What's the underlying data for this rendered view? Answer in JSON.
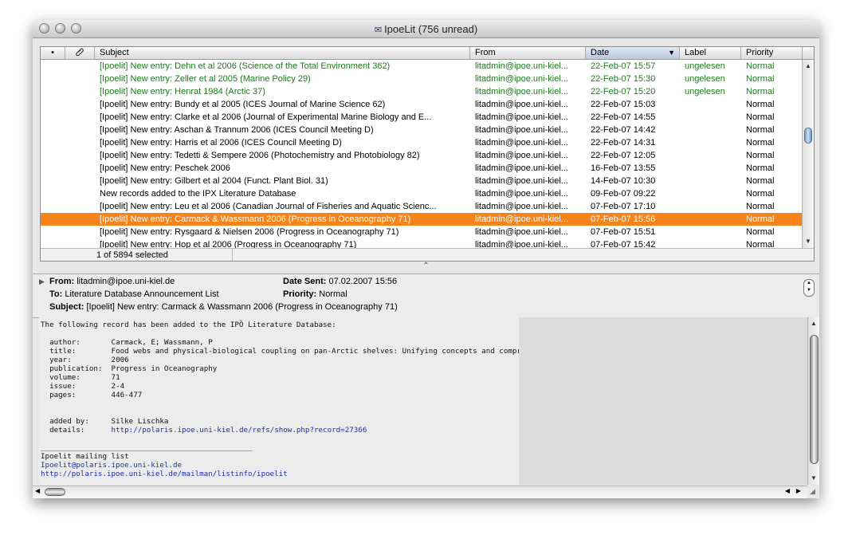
{
  "window": {
    "title": "IpoeLit (756 unread)"
  },
  "colors": {
    "unread_text": "#1b7b1b",
    "selected_row": "#f7841b",
    "link": "#1a2fa8"
  },
  "columns": {
    "dot": "•",
    "attachment_icon": "paperclip-icon",
    "subject": "Subject",
    "from": "From",
    "date": "Date",
    "label": "Label",
    "priority": "Priority"
  },
  "messages": [
    {
      "subject": "[Ipoelit] New entry: Dehn et al 2006 (Science of the Total Environment 362)",
      "from": "litadmin@ipoe.uni-kiel...",
      "date": "22-Feb-07 15:57",
      "label": "ungelesen",
      "priority": "Normal",
      "state": "unread"
    },
    {
      "subject": "[Ipoelit] New entry: Zeller et al 2005 (Marine Policy 29)",
      "from": "litadmin@ipoe.uni-kiel...",
      "date": "22-Feb-07 15:30",
      "label": "ungelesen",
      "priority": "Normal",
      "state": "unread"
    },
    {
      "subject": "[Ipoelit] New entry: Henrat 1984 (Arctic 37)",
      "from": "litadmin@ipoe.uni-kiel...",
      "date": "22-Feb-07 15:20",
      "label": "ungelesen",
      "priority": "Normal",
      "state": "unread"
    },
    {
      "subject": "[Ipoelit] New entry: Bundy et al 2005 (ICES Journal of Marine Science 62)",
      "from": "litadmin@ipoe.uni-kiel...",
      "date": "22-Feb-07 15:03",
      "label": "",
      "priority": "Normal",
      "state": "read"
    },
    {
      "subject": "[Ipoelit] New entry: Clarke et al 2006 (Journal of Experimental Marine Biology and E...",
      "from": "litadmin@ipoe.uni-kiel...",
      "date": "22-Feb-07 14:55",
      "label": "",
      "priority": "Normal",
      "state": "read"
    },
    {
      "subject": "[Ipoelit] New entry: Aschan & Trannum 2006 (ICES Council Meeting D)",
      "from": "litadmin@ipoe.uni-kiel...",
      "date": "22-Feb-07 14:42",
      "label": "",
      "priority": "Normal",
      "state": "read"
    },
    {
      "subject": "[Ipoelit] New entry: Harris et al 2006 (ICES Council Meeting D)",
      "from": "litadmin@ipoe.uni-kiel...",
      "date": "22-Feb-07 14:31",
      "label": "",
      "priority": "Normal",
      "state": "read"
    },
    {
      "subject": "[Ipoelit] New entry: Tedetti & Sempere 2006 (Photochemistry and Photobiology 82)",
      "from": "litadmin@ipoe.uni-kiel...",
      "date": "22-Feb-07 12:05",
      "label": "",
      "priority": "Normal",
      "state": "read"
    },
    {
      "subject": "[Ipoelit] New entry: Peschek 2006",
      "from": "litadmin@ipoe.uni-kiel...",
      "date": "16-Feb-07 13:55",
      "label": "",
      "priority": "Normal",
      "state": "read"
    },
    {
      "subject": "[Ipoelit] New entry: Gilbert et al 2004 (Funct. Plant Biol. 31)",
      "from": "litadmin@ipoe.uni-kiel...",
      "date": "14-Feb-07 10:30",
      "label": "",
      "priority": "Normal",
      "state": "read"
    },
    {
      "subject": "New records added to the IPX Literature Database",
      "from": "litadmin@ipoe.uni-kiel...",
      "date": "09-Feb-07 09:22",
      "label": "",
      "priority": "Normal",
      "state": "read"
    },
    {
      "subject": "[Ipoelit] New entry: Leu et al 2006 (Canadian Journal of Fisheries and Aquatic Scienc...",
      "from": "litadmin@ipoe.uni-kiel...",
      "date": "07-Feb-07 17:10",
      "label": "",
      "priority": "Normal",
      "state": "read"
    },
    {
      "subject": "[Ipoelit] New entry: Carmack & Wassmann 2006 (Progress in Oceanography 71)",
      "from": "litadmin@ipoe.uni-kiel...",
      "date": "07-Feb-07 15:56",
      "label": "",
      "priority": "Normal",
      "state": "selected"
    },
    {
      "subject": "[Ipoelit] New entry: Rysgaard & Nielsen 2006 (Progress in Oceanography 71)",
      "from": "litadmin@ipoe.uni-kiel...",
      "date": "07-Feb-07 15:51",
      "label": "",
      "priority": "Normal",
      "state": "read"
    },
    {
      "subject": "[Ipoelit] New entry: Hop et al 2006 (Progress in Oceanography 71)",
      "from": "litadmin@ipoe.uni-kiel...",
      "date": "07-Feb-07 15:42",
      "label": "",
      "priority": "Normal",
      "state": "read"
    }
  ],
  "status": {
    "selection": "1 of 5894 selected"
  },
  "splitter": {
    "glyph": "⌃"
  },
  "header": {
    "from_label": "From:",
    "from_value": "litadmin@ipoe.uni-kiel.de",
    "to_label": "To:",
    "to_value": "Literature Database Announcement List",
    "subject_label": "Subject:",
    "subject_value": "[Ipoelit] New entry: Carmack & Wassmann 2006 (Progress in Oceanography 71)",
    "date_label": "Date Sent:",
    "date_value": "07.02.2007 15:56",
    "priority_label": "Priority:",
    "priority_value": "Normal"
  },
  "body": {
    "intro": "The following record has been added to the IPÖ Literature Database:",
    "fields": [
      {
        "key": "author:",
        "value": "Carmack, E; Wassmann, P"
      },
      {
        "key": "title:",
        "value": "Food webs and physical-biological coupling on pan-Arctic shelves: Unifying concepts and comprehensive perspectives"
      },
      {
        "key": "year:",
        "value": "2006"
      },
      {
        "key": "publication:",
        "value": "Progress in Oceanography"
      },
      {
        "key": "volume:",
        "value": "71"
      },
      {
        "key": "issue:",
        "value": "2-4"
      },
      {
        "key": "pages:",
        "value": "446-477"
      }
    ],
    "added_by_key": "added by:",
    "added_by_value": "Silke Lischka",
    "details_key": "details:",
    "details_url": "http://polaris.ipoe.uni-kiel.de/refs/show.php?record=27366",
    "separator": "________________________________________________",
    "footer_list": "Ipoelit mailing list",
    "footer_email": "Ipoelit@polaris.ipoe.uni-kiel.de",
    "footer_url": "http://polaris.ipoe.uni-kiel.de/mailman/listinfo/ipoelit"
  }
}
